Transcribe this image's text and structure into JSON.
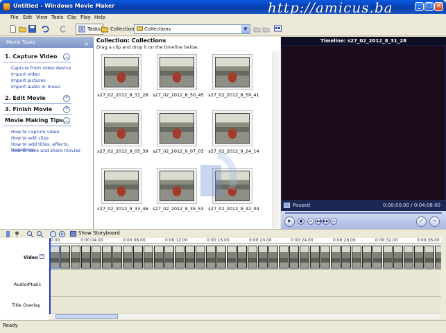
{
  "window": {
    "title": "Untitled - Windows Movie Maker",
    "watermark": "http://amicus.ba",
    "min_label": "_",
    "max_label": "□",
    "close_label": "✕"
  },
  "menu": [
    "File",
    "Edit",
    "View",
    "Tools",
    "Clip",
    "Play",
    "Help"
  ],
  "toolbar": {
    "tasks_label": "Tasks",
    "collections_label": "Collections",
    "location_value": "Collections"
  },
  "taskpane": {
    "header": "Movie Tasks",
    "close_label": "×",
    "sections": [
      {
        "title": "1. Capture Video",
        "toggle": "︽",
        "links": [
          "Capture from video device",
          "Import video",
          "Import pictures",
          "Import audio or music"
        ]
      },
      {
        "title": "2. Edit Movie",
        "toggle": "︾",
        "links": []
      },
      {
        "title": "3. Finish Movie",
        "toggle": "︾",
        "links": []
      },
      {
        "title": "Movie Making Tips",
        "toggle": "︽",
        "links": [
          "How to capture video",
          "How to edit clips",
          "How to add titles, effects, transitions",
          "How to save and share movies"
        ]
      }
    ]
  },
  "collection": {
    "title": "Collection: Collections",
    "subtitle": "Drag a clip and drop it on the timeline below.",
    "clips": [
      "s27_02_2012_8_31_28",
      "s27_02_2012_8_50_45",
      "s27_02_2012_8_59_41",
      "s27_02_2012_9_05_39",
      "s27_02_2012_9_07_03",
      "s27_02_2012_9_24_14",
      "s27_02_2012_9_33_46",
      "s27_02_2012_9_35_53",
      "s27_02_2012_9_42_04"
    ]
  },
  "monitor": {
    "title": "Timeline: s27_02_2012_8_31_28",
    "status": "Paused",
    "time": "0:00:00.00 / 0:04:08.00",
    "controls": {
      "play": "▶",
      "stop": "■",
      "prev": "⏮",
      "rew": "◀◀",
      "ff": "▶▶",
      "next": "⏭",
      "fullscreen": "⤢",
      "split": "✂"
    }
  },
  "timeline": {
    "show_storyboard": "Show Storyboard",
    "plus_label": "+",
    "tracks": [
      "Video",
      "Audio/Music",
      "Title Overlay"
    ],
    "ruler_ticks": [
      "0.00",
      "0:00:04.00",
      "0:00:08.00",
      "0:00:12.00",
      "0:00:16.00",
      "0:00:20.00",
      "0:00:24.00",
      "0:00:28.00",
      "0:00:32.00",
      "0:00:36.00"
    ]
  },
  "statusbar": {
    "text": "Ready"
  },
  "colors": {
    "titlebar": "#0842b8",
    "taskpane_header": "#7d95c7",
    "link": "#1c3fb0",
    "monitor_bg": "#1b1b40"
  }
}
